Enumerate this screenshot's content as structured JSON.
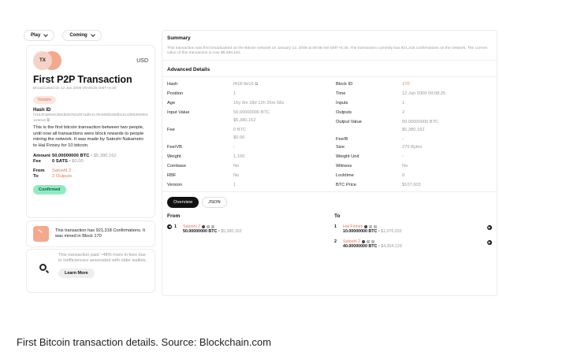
{
  "topbar": {
    "filters": [
      {
        "label": "Play"
      },
      {
        "label": "Coming"
      }
    ]
  },
  "card": {
    "badge_text": "TX",
    "currency": "USD",
    "title": "First P2P Transaction",
    "broadcast": "Broadcasted on 12 Jan 2009 09:08:25 GMT+5:30",
    "notable": "Notable",
    "hash_label": "Hash ID",
    "hash_value": "f4184fc596403b9d638783cf57adfe4c75c605f6356fbc91338530e9831e9e16",
    "description": "This is the first bitcoin transaction between two people, until now all transactions were block rewards to people mining the network. It was made by Satoshi Nakamoto to Hal Finney for 10 bitcoin.",
    "amount_label": "Amount",
    "amount_btc": "50.00000000 BTC",
    "amount_usd": "$5,380,162",
    "fee_label": "Fee",
    "fee_sats": "0 SATS",
    "fee_usd": "$0.00",
    "from_label": "From",
    "from_value": "Satoshi 2",
    "to_label": "To",
    "to_value": "2 Outputs",
    "status": "Confirmed"
  },
  "info1": {
    "text": "This transaction has 921,318 Confirmations. It was mined in Block 170"
  },
  "info2": {
    "text": "This transaction paid ~48% more in fees due to inefficiencies associated with older wallets.",
    "button": "Learn More"
  },
  "summary": {
    "heading": "Summary",
    "text": "This transaction was first broadcasted on the Bitcoin network on January 12, 2009 at 09:08 AM GMT+5:30. The transaction currently has 921,318 confirmations on the network. The current value of this transaction is now $5,380,162."
  },
  "advanced": {
    "heading": "Advanced Details",
    "left": [
      {
        "label": "Hash",
        "value": "f418-9e16"
      },
      {
        "label": "Position",
        "value": "1"
      },
      {
        "label": "Age",
        "value": "16y 9m 18d 12h 25m 58s"
      },
      {
        "label": "Input Value",
        "value": "50.00000000 BTC"
      },
      {
        "label": "",
        "value": "$5,380,162"
      },
      {
        "label": "Fee",
        "value": "0 BTC"
      },
      {
        "label": "",
        "value": "$0.00"
      },
      {
        "label": "Fee/VB",
        "value": "-"
      },
      {
        "label": "Weight",
        "value": "1,100"
      },
      {
        "label": "Coinbase",
        "value": "No"
      },
      {
        "label": "RBF",
        "value": "No"
      },
      {
        "label": "Version",
        "value": "1"
      }
    ],
    "right": [
      {
        "label": "Block ID",
        "value": "170"
      },
      {
        "label": "Time",
        "value": "12 Jan 2009 09:08:25"
      },
      {
        "label": "Inputs",
        "value": "1"
      },
      {
        "label": "Outputs",
        "value": "2"
      },
      {
        "label": "Output Value",
        "value": "50.00000000 BTC"
      },
      {
        "label": "",
        "value": "$5,380,162"
      },
      {
        "label": "Fee/B",
        "value": "-"
      },
      {
        "label": "Size",
        "value": "275 Bytes"
      },
      {
        "label": "Weight Unit",
        "value": "-"
      },
      {
        "label": "Witness",
        "value": "No"
      },
      {
        "label": "Locktime",
        "value": "0"
      },
      {
        "label": "BTC Price",
        "value": "$107,603"
      }
    ]
  },
  "tabs": [
    {
      "label": "Overview"
    },
    {
      "label": "JSON"
    }
  ],
  "from": {
    "heading": "From",
    "items": [
      {
        "index": "1",
        "name": "Satoshi 2",
        "amount": "50.00000000 BTC",
        "usd": "$5,380,162"
      }
    ]
  },
  "to": {
    "heading": "To",
    "items": [
      {
        "index": "1",
        "name": "Hal Finney",
        "amount": "10.00000000 BTC",
        "usd": "$1,076,032"
      },
      {
        "index": "2",
        "name": "Satoshi 2",
        "amount": "40.00000000 BTC",
        "usd": "$4,304,129"
      }
    ]
  },
  "caption": "First Bitcoin transaction details. Source: Blockchain.com",
  "colors": {
    "accent": "#e0795a",
    "confirmed_bg": "#8eecc4",
    "badge_peach": "#f3a98e"
  }
}
